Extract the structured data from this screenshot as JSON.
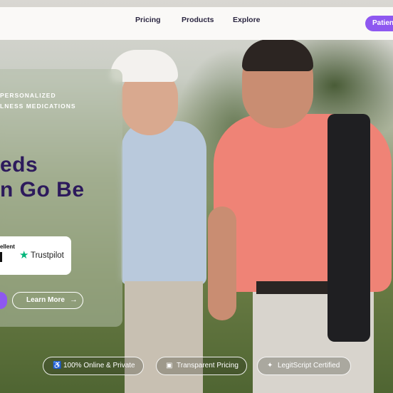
{
  "nav": {
    "links": [
      "Pricing",
      "Products",
      "Explore"
    ],
    "cta_label": "Patient"
  },
  "hero": {
    "tagline_lines": [
      "PERSONALIZED",
      "LNESS MEDICATIONS"
    ],
    "headline_lines": [
      "eds",
      "n Go Be"
    ],
    "trust": {
      "rating_text": "ellent",
      "brand": "Trustpilot"
    },
    "learn_more_label": "Learn More",
    "learn_more_arrow": "→"
  },
  "badges": [
    {
      "icon": "accessibility-icon",
      "label": "100% Online & Private"
    },
    {
      "icon": "price-tag-icon",
      "label": "Transparent Pricing"
    },
    {
      "icon": "certified-icon",
      "label": "LegitScript Certified"
    }
  ],
  "colors": {
    "accent": "#8e58f0",
    "headline": "#2d1a5c",
    "trustpilot_green": "#00b67a"
  }
}
